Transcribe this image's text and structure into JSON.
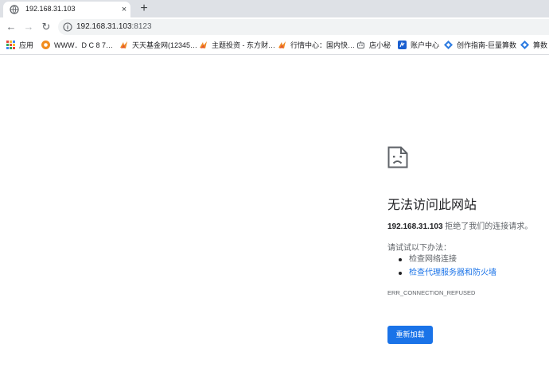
{
  "tab": {
    "title": "192.168.31.103",
    "close_glyph": "×",
    "new_tab_glyph": "+"
  },
  "toolbar": {
    "back_glyph": "←",
    "forward_glyph": "→",
    "reload_glyph": "↻",
    "url_host": "192.168.31.103",
    "url_port": ":8123"
  },
  "bookmarks": [
    {
      "label": "应用",
      "icon": "apps-grid-icon",
      "color": "#e8453c"
    },
    {
      "label": "WWW．D C 8 7…",
      "icon": "circle-logo-icon",
      "color": "#f28c1d"
    },
    {
      "label": "天天基金网(12345…",
      "icon": "flame-icon",
      "color": "#f08a24"
    },
    {
      "label": "主题投资 - 东方财…",
      "icon": "flame-icon",
      "color": "#f08a24"
    },
    {
      "label": "行情中心：国内快…",
      "icon": "flame-icon",
      "color": "#f08a24"
    },
    {
      "label": "店小秘",
      "icon": "robot-icon",
      "color": "#5f6368"
    },
    {
      "label": "账户中心",
      "icon": "account-icon",
      "color": "#1a5fd0"
    },
    {
      "label": "创作指南-巨量算数",
      "icon": "diamond-icon",
      "color": "#2f7de1"
    },
    {
      "label": "算数",
      "icon": "diamond-icon",
      "color": "#2f7de1"
    }
  ],
  "error": {
    "title": "无法访问此网站",
    "host": "192.168.31.103",
    "detail_suffix": " 拒绝了我们的连接请求。",
    "suggest_intro": "请试试以下办法：",
    "suggestions": [
      "检查网络连接",
      "检查代理服务器和防火墙"
    ],
    "code": "ERR_CONNECTION_REFUSED",
    "reload_label": "重新加载"
  },
  "colors": {
    "accent": "#1a73e8",
    "tabstrip": "#dee1e6",
    "omnibox": "#f1f3f4"
  }
}
